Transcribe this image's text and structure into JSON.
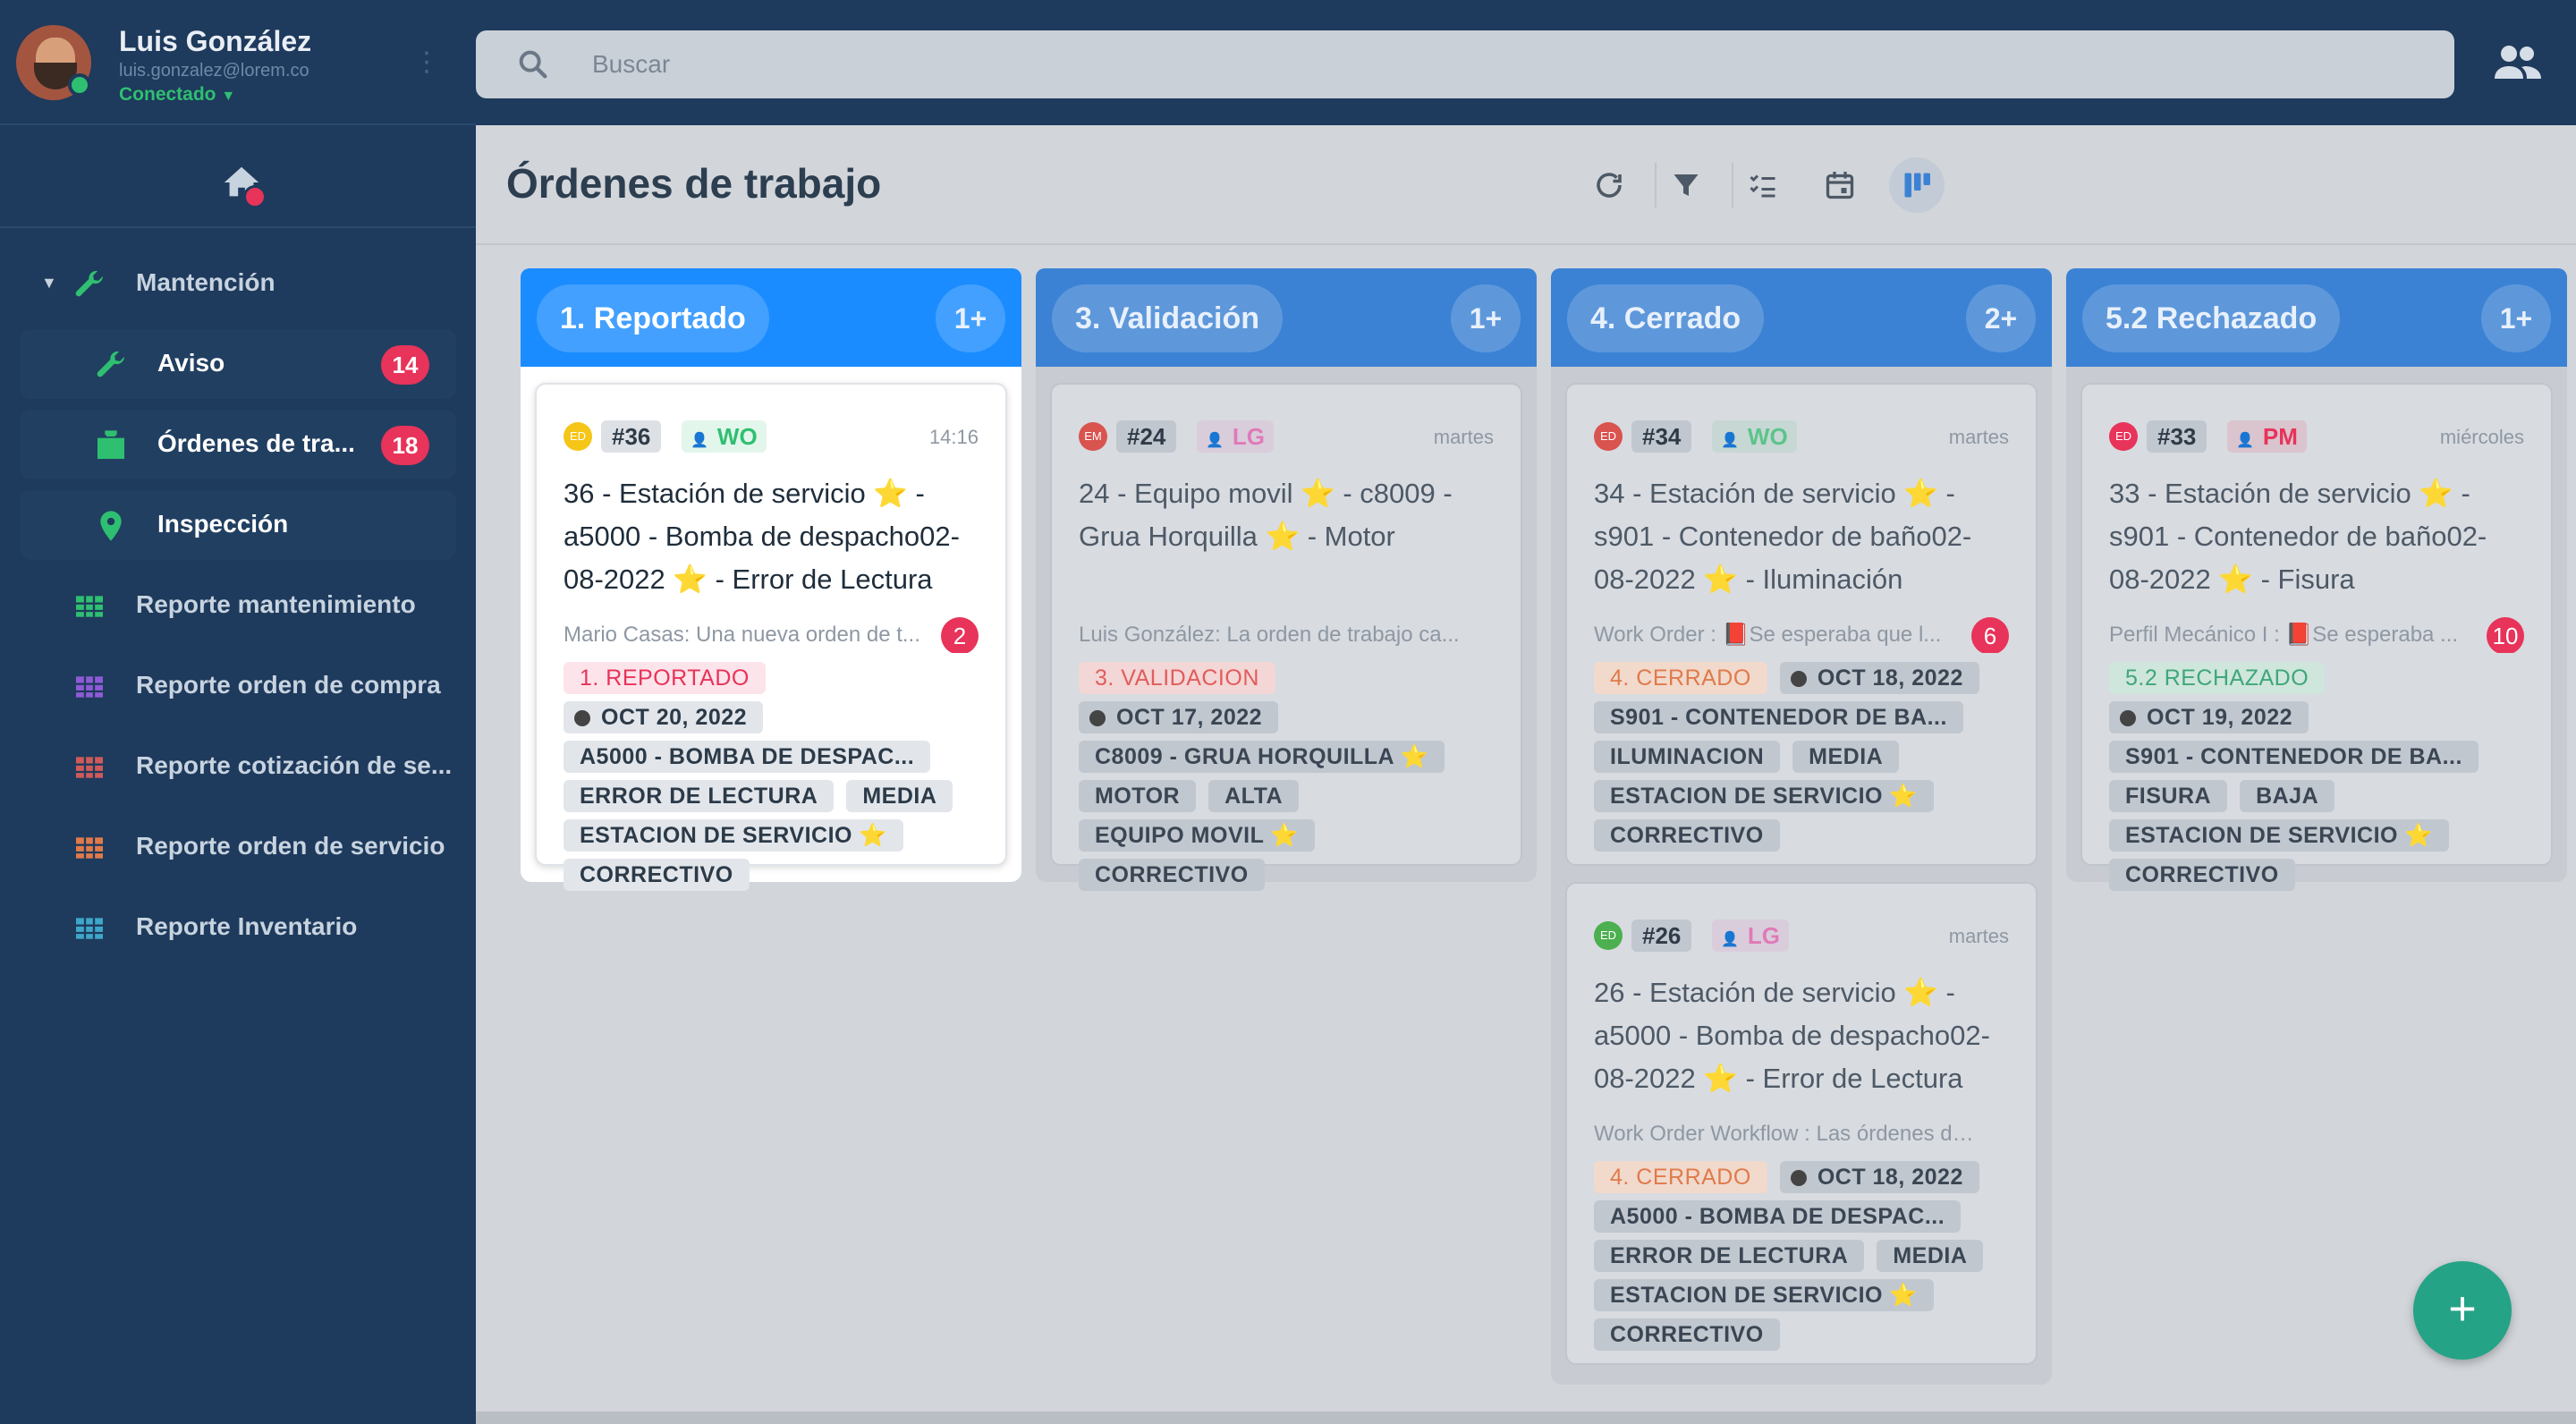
{
  "user": {
    "name": "Luis González",
    "email": "luis.gonzalez@lorem.co",
    "status": "Conectado"
  },
  "search": {
    "placeholder": "Buscar"
  },
  "sidebar": {
    "section": "Mantención",
    "items": [
      {
        "label": "Aviso",
        "badge": "14",
        "icon": "wrench-icon",
        "color": "#2fbf71"
      },
      {
        "label": "Órdenes de tra...",
        "badge": "18",
        "icon": "briefcase-icon",
        "color": "#2fbf71"
      },
      {
        "label": "Inspección",
        "badge": "",
        "icon": "location-pin-icon",
        "color": "#2fbf71"
      },
      {
        "label": "Reporte mantenimiento",
        "icon": "table-icon",
        "color": "#2fbf71"
      },
      {
        "label": "Reporte orden de compra",
        "icon": "table-icon",
        "color": "#8e5bd6"
      },
      {
        "label": "Reporte cotización de se...",
        "icon": "table-icon",
        "color": "#d05a5a"
      },
      {
        "label": "Reporte orden de servicio",
        "icon": "table-icon",
        "color": "#e07a4a"
      },
      {
        "label": "Reporte Inventario",
        "icon": "table-icon",
        "color": "#3fa7c9"
      }
    ]
  },
  "page": {
    "title": "Órdenes de trabajo"
  },
  "toolbar": [
    "refresh-icon",
    "filter-icon",
    "checklist-icon",
    "calendar-icon",
    "kanban-icon"
  ],
  "colors": {
    "accent": "#1a8cff",
    "badge": "#e8335a",
    "fab": "#25a386",
    "sidebar": "#1e3a5c"
  },
  "columns": [
    {
      "name": "1. Reportado",
      "count": "1+",
      "cards": [
        {
          "avatar": "ED",
          "avatar_color": "#f5c518",
          "number": "#36",
          "workflow": "WO",
          "workflow_color": "#2fbf71",
          "when": "14:16",
          "title": "36 - Estación de servicio ⭐ - a5000 - Bomba de despacho02-08-2022 ⭐ - Error de Lectura",
          "preview": "Mario Casas: Una nueva orden de t...",
          "preview_count": "2",
          "state": "1. REPORTADO",
          "state_color": "#e8335a",
          "state_bg": "#fde3ea",
          "date": "OCT 20, 2022",
          "tags": [
            "A5000 - BOMBA DE DESPAC...",
            "ERROR DE LECTURA",
            "MEDIA",
            "ESTACION DE SERVICIO ⭐",
            "CORRECTIVO"
          ]
        }
      ]
    },
    {
      "name": "3. Validación",
      "count": "1+",
      "cards": [
        {
          "avatar": "EM",
          "avatar_color": "#d9534f",
          "number": "#24",
          "workflow": "LG",
          "workflow_color": "#e07ab8",
          "when": "martes",
          "title": "24 - Equipo movil ⭐ - c8009 - Grua Horquilla ⭐ - Motor",
          "preview": "Luis González: La orden de trabajo ca...",
          "preview_count": "",
          "state": "3. VALIDACION",
          "state_color": "#e25c5c",
          "state_bg": "#f3d6d6",
          "date": "OCT 17, 2022",
          "tags": [
            "C8009 - GRUA HORQUILLA ⭐",
            "MOTOR",
            "ALTA",
            "EQUIPO MOVIL ⭐",
            "CORRECTIVO"
          ]
        }
      ]
    },
    {
      "name": "4. Cerrado",
      "count": "2+",
      "cards": [
        {
          "avatar": "ED",
          "avatar_color": "#d9534f",
          "number": "#34",
          "workflow": "WO",
          "workflow_color": "#5cc48a",
          "when": "martes",
          "title": "34 - Estación de servicio ⭐ - s901 - Contenedor de baño02-08-2022 ⭐ - Iluminación",
          "preview": "Work Order : 📕Se esperaba que l...",
          "preview_count": "6",
          "state": "4. CERRADO",
          "state_color": "#e07a4a",
          "state_bg": "#f1d9cc",
          "date": "OCT 18, 2022",
          "tags": [
            "S901 - CONTENEDOR DE BA...",
            "ILUMINACION",
            "MEDIA",
            "ESTACION DE SERVICIO ⭐",
            "CORRECTIVO"
          ]
        },
        {
          "avatar": "ED",
          "avatar_color": "#4caf50",
          "number": "#26",
          "workflow": "LG",
          "workflow_color": "#e07ab8",
          "when": "martes",
          "title": "26 - Estación de servicio ⭐ - a5000 - Bomba de despacho02-08-2022 ⭐ - Error de Lectura",
          "preview": "Work Order Workflow : Las órdenes de...",
          "preview_count": "",
          "state": "4. CERRADO",
          "state_color": "#e07a4a",
          "state_bg": "#f1d9cc",
          "date": "OCT 18, 2022",
          "tags": [
            "A5000 - BOMBA DE DESPAC...",
            "ERROR DE LECTURA",
            "MEDIA",
            "ESTACION DE SERVICIO ⭐",
            "CORRECTIVO"
          ]
        }
      ]
    },
    {
      "name": "5.2 Rechazado",
      "count": "1+",
      "cards": [
        {
          "avatar": "ED",
          "avatar_color": "#e8335a",
          "number": "#33",
          "workflow": "PM",
          "workflow_color": "#e8335a",
          "when": "miércoles",
          "title": "33 - Estación de servicio ⭐ - s901 - Contenedor de baño02-08-2022 ⭐ - Fisura",
          "preview": "Perfil Mecánico I : 📕Se esperaba ...",
          "preview_count": "10",
          "state": "5.2 RECHAZADO",
          "state_color": "#3fa77a",
          "state_bg": "#cfe6dc",
          "date": "OCT 19, 2022",
          "tags": [
            "S901 - CONTENEDOR DE BA...",
            "FISURA",
            "BAJA",
            "ESTACION DE SERVICIO ⭐",
            "CORRECTIVO"
          ]
        }
      ]
    }
  ],
  "fab": {
    "label": "+"
  }
}
